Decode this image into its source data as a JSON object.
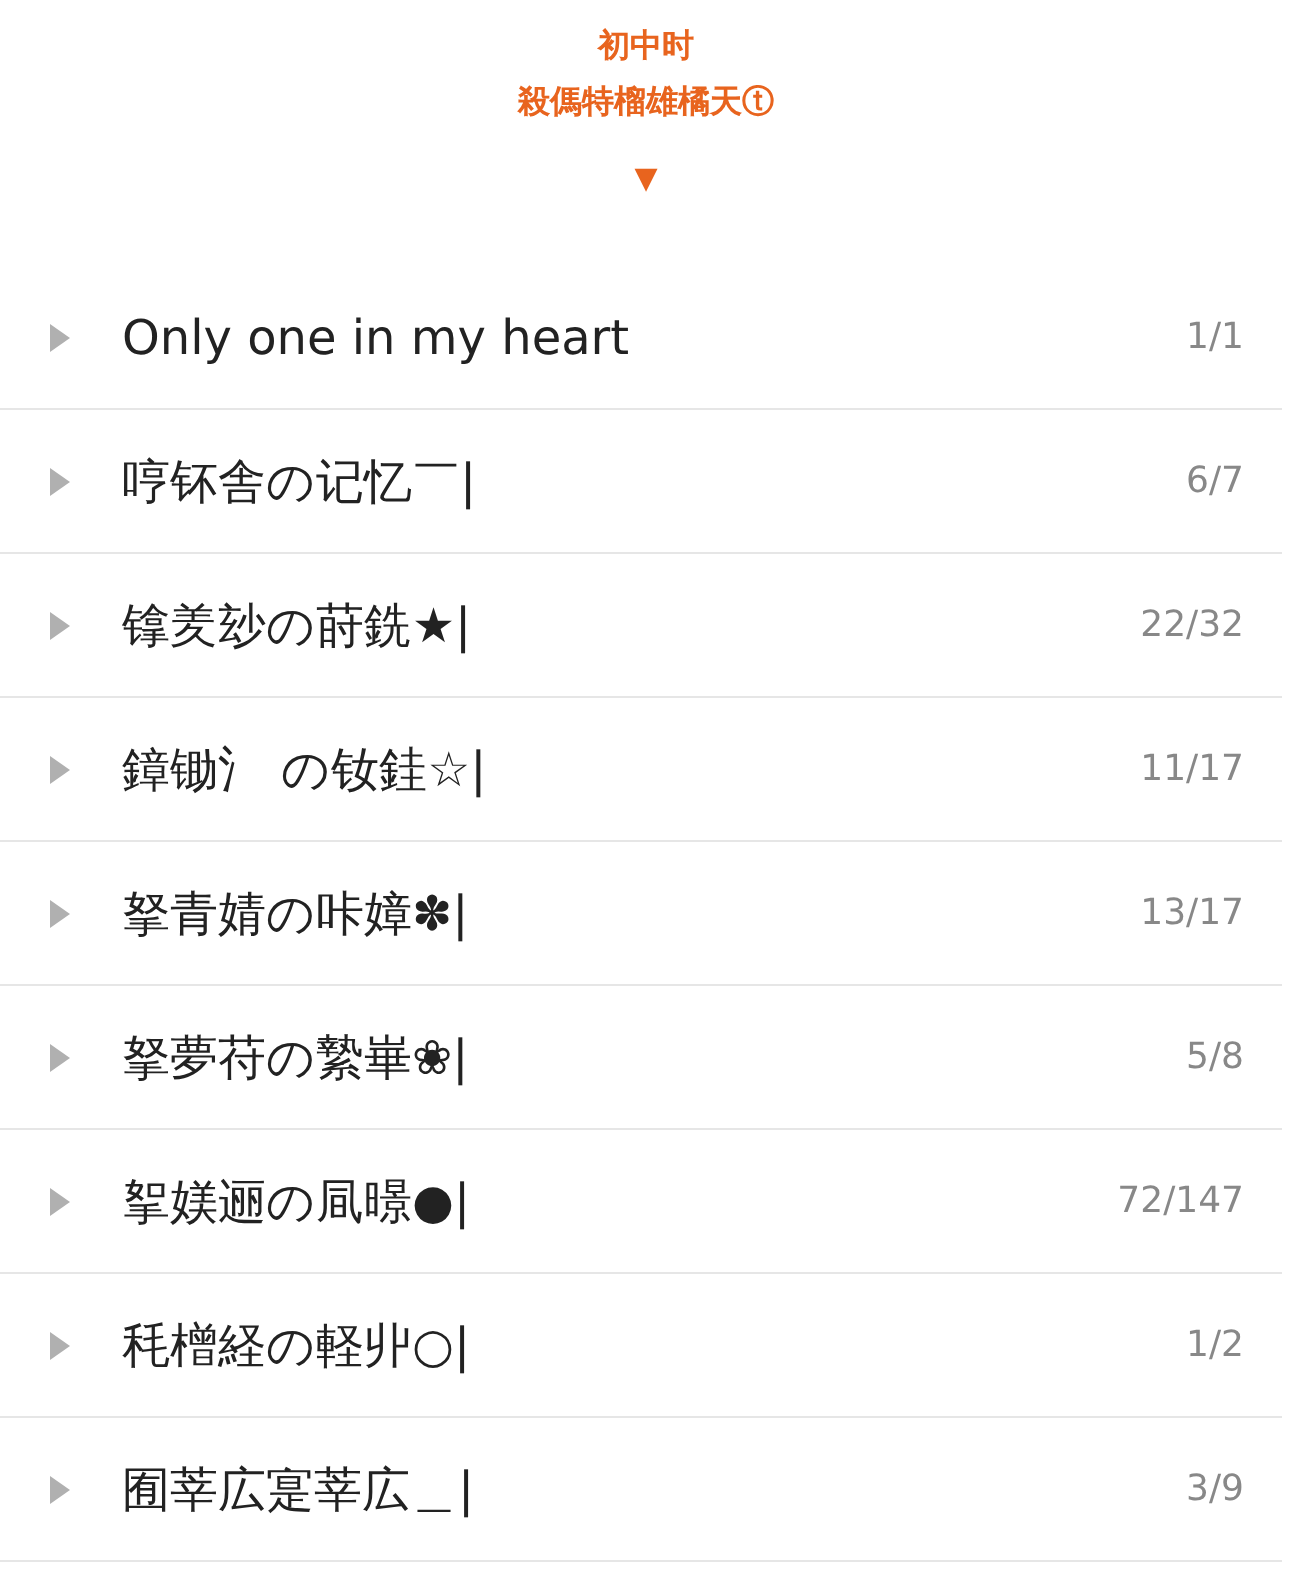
{
  "header": {
    "title": "初中时",
    "subtitle": "殺傌特榴雄橘天ⓣ",
    "toggle": "▼"
  },
  "groups": [
    {
      "name": "Only one in my heart",
      "count": "1/1",
      "expanded": false
    },
    {
      "name": "哼钚舎の记忆￣|",
      "count": "6/7",
      "expanded": false
    },
    {
      "name": "镎羑玅の莳銑★|",
      "count": "22/32",
      "expanded": false
    },
    {
      "name": "鏱锄氵 の钕銈☆|",
      "count": "11/17",
      "expanded": false
    },
    {
      "name": "拏青婧の咔嫜✽|",
      "count": "13/17",
      "expanded": false
    },
    {
      "name": "拏夢苻の縶崋❀|",
      "count": "5/8",
      "expanded": false
    },
    {
      "name": "挐媄逦の凬暻●|",
      "count": "72/147",
      "expanded": false
    },
    {
      "name": "秏橧経の軽丱○|",
      "count": "1/2",
      "expanded": false
    },
    {
      "name": "囿莘広寔莘広＿|",
      "count": "3/9",
      "expanded": false
    }
  ]
}
